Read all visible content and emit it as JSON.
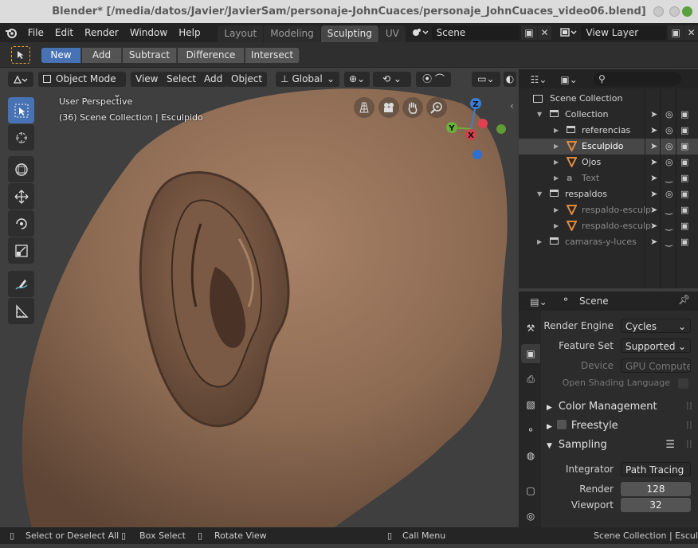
{
  "window": {
    "title": "Blender* [/media/datos/Javier/JavierSam/personaje-JohnCuaces/personaje_JohnCuaces_video06.blend]"
  },
  "menu": [
    "File",
    "Edit",
    "Render",
    "Window",
    "Help"
  ],
  "workspaces": [
    {
      "label": "Layout",
      "active": false
    },
    {
      "label": "Modeling",
      "active": false
    },
    {
      "label": "Sculpting",
      "active": true
    },
    {
      "label": "UV",
      "active": false
    }
  ],
  "scene_field": "Scene",
  "view_layer_field": "View Layer",
  "tool_options": {
    "buttons": [
      "New",
      "Add",
      "Subtract",
      "Difference",
      "Intersect"
    ],
    "active": "New"
  },
  "viewport_header": {
    "mode": "Object Mode",
    "menus": [
      "View",
      "Select",
      "Add",
      "Object"
    ],
    "orientation": "Global"
  },
  "viewport": {
    "perspective": "User Perspective",
    "collection_info": "(36) Scene Collection | Esculpido"
  },
  "gizmo": {
    "z": "Z",
    "y": "Y",
    "x": "X"
  },
  "outliner": {
    "root": "Scene Collection",
    "rows": [
      {
        "label": "Collection",
        "indent": 1,
        "icon": "collection-icon",
        "expanded": true,
        "dim": false,
        "selected": false
      },
      {
        "label": "referencias",
        "indent": 2,
        "icon": "collection-icon",
        "expanded": false,
        "dim": false,
        "selected": false
      },
      {
        "label": "Esculpido",
        "indent": 2,
        "icon": "mesh-icon",
        "expanded": false,
        "dim": false,
        "selected": true
      },
      {
        "label": "Ojos",
        "indent": 2,
        "icon": "mesh-icon",
        "expanded": false,
        "dim": false,
        "selected": false
      },
      {
        "label": "Text",
        "indent": 2,
        "icon": "text-icon",
        "expanded": false,
        "dim": true,
        "selected": false
      },
      {
        "label": "respaldos",
        "indent": 1,
        "icon": "collection-icon",
        "expanded": true,
        "dim": false,
        "selected": false
      },
      {
        "label": "respaldo-esculp",
        "indent": 2,
        "icon": "mesh-icon",
        "expanded": false,
        "dim": true,
        "selected": false
      },
      {
        "label": "respaldo-esculp",
        "indent": 2,
        "icon": "mesh-icon",
        "expanded": false,
        "dim": true,
        "selected": false
      },
      {
        "label": "camaras-y-luces",
        "indent": 1,
        "icon": "collection-icon",
        "expanded": false,
        "dim": true,
        "selected": false
      }
    ]
  },
  "properties": {
    "context": "Scene",
    "render_engine_label": "Render Engine",
    "render_engine": "Cycles",
    "feature_set_label": "Feature Set",
    "feature_set": "Supported",
    "device_label": "Device",
    "device": "GPU Compute",
    "osl_label": "Open Shading Language",
    "panels": [
      "Color Management",
      "Freestyle",
      "Sampling"
    ],
    "integrator_label": "Integrator",
    "integrator": "Path Tracing",
    "render_label": "Render",
    "render_samples": "128",
    "viewport_label": "Viewport",
    "viewport_samples": "32"
  },
  "status": {
    "select": "Select or Deselect All",
    "box": "Box Select",
    "rotate": "Rotate View",
    "menu": "Call Menu",
    "right": "Scene Collection | Esculpido"
  }
}
